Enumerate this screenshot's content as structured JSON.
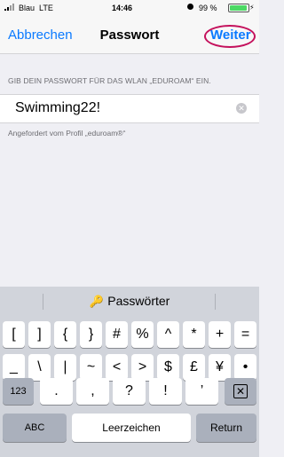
{
  "status_bar": {
    "carrier": "Blau",
    "network": "LTE",
    "time": "14:46",
    "battery_percent": "99 %",
    "battery_color": "#4cd964"
  },
  "nav": {
    "cancel_label": "Abbrechen",
    "title": "Passwort",
    "next_label": "Weiter"
  },
  "form": {
    "section_header": "GIB DEIN PASSWORT FÜR DAS WLAN „EDUROAM“ EIN.",
    "password_value": "Swimming22!",
    "footer_note": "Angefordert vom Profil „eduroam®“"
  },
  "keyboard": {
    "suggestion_label": "Passwörter",
    "row1": [
      "[",
      "]",
      "{",
      "}",
      "#",
      "%",
      "^",
      "*",
      "+",
      "="
    ],
    "row2": [
      "_",
      "\\",
      "|",
      "~",
      "<",
      ">",
      "$",
      "£",
      "¥",
      "•"
    ],
    "mode_123": "123",
    "row3": [
      ".",
      ",",
      "?",
      "!",
      "’"
    ],
    "abc_label": "ABC",
    "space_label": "Leerzeichen",
    "return_label": "Return"
  },
  "colors": {
    "accent": "#0a7aff",
    "highlight_ring": "#c4115c"
  }
}
